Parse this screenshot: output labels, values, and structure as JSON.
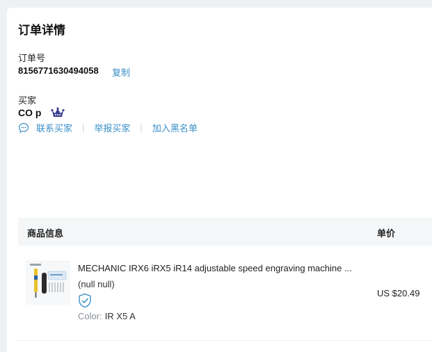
{
  "page": {
    "title": "订单详情"
  },
  "order": {
    "label": "订单号",
    "number": "8156771630494058",
    "copy_label": "复制"
  },
  "buyer": {
    "label": "买家",
    "name": "CO p",
    "badge_icon": "crown-icon",
    "actions": {
      "contact_label": "联系买家",
      "report_label": "举报买家",
      "blacklist_label": "加入黑名单"
    }
  },
  "table": {
    "headers": {
      "product": "商品信息",
      "unit_price": "单价"
    },
    "rows": [
      {
        "title": "MECHANIC IRX6 iRX5 iR14 adjustable speed engraving machine ...",
        "subtitle": "(null null)",
        "badge_icon": "shield-check-icon",
        "attr_key": "Color:",
        "attr_value": "IR X5 A",
        "price": "US $20.49"
      }
    ]
  },
  "colors": {
    "link": "#3a8fc6",
    "crown": "#3b3f8f",
    "header_bg": "#f4f6f8",
    "page_bg": "#eef0f3"
  }
}
